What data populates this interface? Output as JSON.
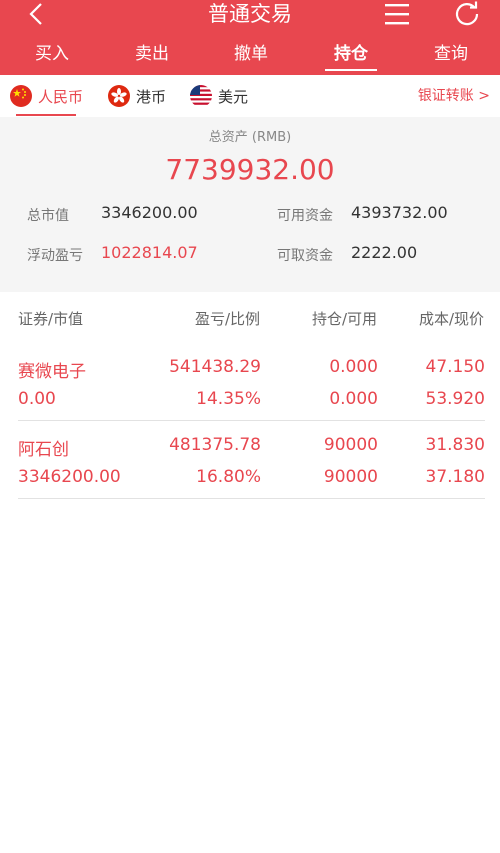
{
  "header": {
    "title": "普通交易",
    "tabs": [
      {
        "label": "买入",
        "active": false
      },
      {
        "label": "卖出",
        "active": false
      },
      {
        "label": "撤单",
        "active": false
      },
      {
        "label": "持仓",
        "active": true
      },
      {
        "label": "查询",
        "active": false
      }
    ],
    "icons": [
      "back-icon",
      "menu-icon",
      "refresh-icon"
    ]
  },
  "currencies": [
    {
      "label": "人民币",
      "flag": "china-flag-icon",
      "active": true
    },
    {
      "label": "港币",
      "flag": "hongkong-flag-icon",
      "active": false
    },
    {
      "label": "美元",
      "flag": "usa-flag-icon",
      "active": false
    }
  ],
  "transfer_link": "银证转账 >",
  "summary": {
    "total_label": "总资产 (RMB)",
    "total_value": "7739932.00",
    "market_value_label": "总市值",
    "market_value": "3346200.00",
    "available_label": "可用资金",
    "available": "4393732.00",
    "floating_pl_label": "浮动盈亏",
    "floating_pl": "1022814.07",
    "withdrawable_label": "可取资金",
    "withdrawable": "2222.00"
  },
  "table": {
    "headers": [
      "证券/市值",
      "盈亏/比例",
      "持仓/可用",
      "成本/现价"
    ],
    "rows": [
      {
        "name": "赛微电子",
        "market_value": "0.00",
        "pl": "541438.29",
        "pl_ratio": "14.35%",
        "position": "0.000",
        "available": "0.000",
        "cost": "47.150",
        "price": "53.920"
      },
      {
        "name": "阿石创",
        "market_value": "3346200.00",
        "pl": "481375.78",
        "pl_ratio": "16.80%",
        "position": "90000",
        "available": "90000",
        "cost": "31.830",
        "price": "37.180"
      }
    ]
  },
  "colors": {
    "accent": "#e8474f",
    "summary_bg": "#f5f5f5",
    "header_text": "#ffffff"
  }
}
